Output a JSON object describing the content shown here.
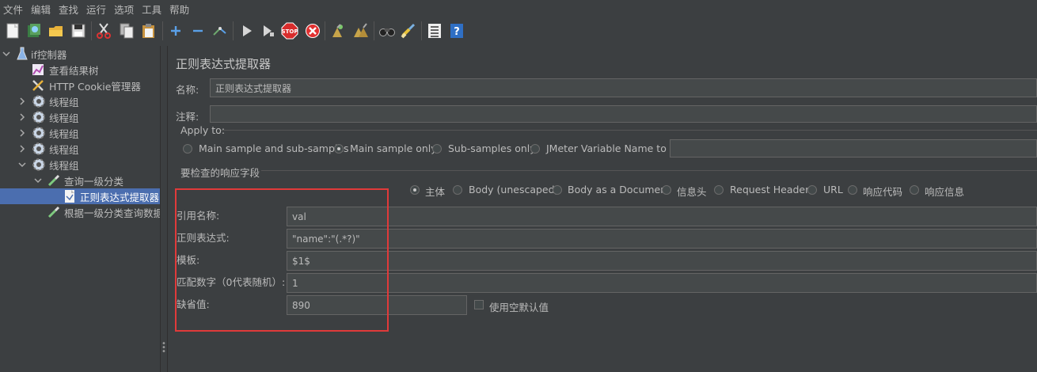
{
  "menu": [
    "文件",
    "编辑",
    "查找",
    "运行",
    "选项",
    "工具",
    "帮助"
  ],
  "toolbar": {
    "icons": [
      "new-icon",
      "templates-icon",
      "open-icon",
      "save-icon",
      "cut-icon",
      "copy-icon",
      "paste-icon",
      "expand-icon",
      "collapse-icon",
      "toggle-icon",
      "start-icon",
      "start-no-pause-icon",
      "stop-icon",
      "shutdown-icon",
      "clear-icon",
      "clear-all-icon",
      "search-icon",
      "reset-search-icon",
      "function-helper-icon",
      "help-icon"
    ],
    "stop_label": "STOP"
  },
  "tree": {
    "nodes": [
      {
        "label": "if控制器",
        "icon": "flask-icon"
      },
      {
        "label": "查看结果树",
        "icon": "chart-icon"
      },
      {
        "label": "HTTP Cookie管理器",
        "icon": "wrench-icon"
      },
      {
        "label": "线程组",
        "icon": "gear-icon"
      },
      {
        "label": "线程组",
        "icon": "gear-icon"
      },
      {
        "label": "线程组",
        "icon": "gear-icon"
      },
      {
        "label": "线程组",
        "icon": "gear-icon"
      },
      {
        "label": "线程组",
        "icon": "gear-icon"
      },
      {
        "label": "查询一级分类",
        "icon": "pipette-icon"
      },
      {
        "label": "正则表达式提取器",
        "icon": "document-icon"
      },
      {
        "label": "根据一级分类查询数据",
        "icon": "pipette-icon"
      }
    ]
  },
  "panel": {
    "title": "正则表达式提取器",
    "name_label": "名称:",
    "name_value": "正则表达式提取器",
    "comment_label": "注释:",
    "comment_value": "",
    "apply_to": {
      "label": "Apply to:",
      "options": [
        "Main sample and sub-samples",
        "Main sample only",
        "Sub-samples only",
        "JMeter Variable Name to use"
      ],
      "selected": 1,
      "var_value": ""
    },
    "field_check": {
      "label": "要检查的响应字段",
      "options": [
        "主体",
        "Body (unescaped)",
        "Body as a Document",
        "信息头",
        "Request Headers",
        "URL",
        "响应代码",
        "响应信息"
      ],
      "selected": 0
    },
    "ref_name_label": "引用名称:",
    "ref_name_value": "val",
    "regex_label": "正则表达式:",
    "regex_value": "\"name\":\"(.*?)\"",
    "template_label": "模板:",
    "template_value": "$1$",
    "match_no_label": "匹配数字（0代表随机）:",
    "match_no_value": "1",
    "default_label": "缺省值:",
    "default_value": "890",
    "empty_default_label": "使用空默认值"
  },
  "colors": {
    "highlight": "#e03a3a",
    "selection": "#4b6eaf"
  }
}
